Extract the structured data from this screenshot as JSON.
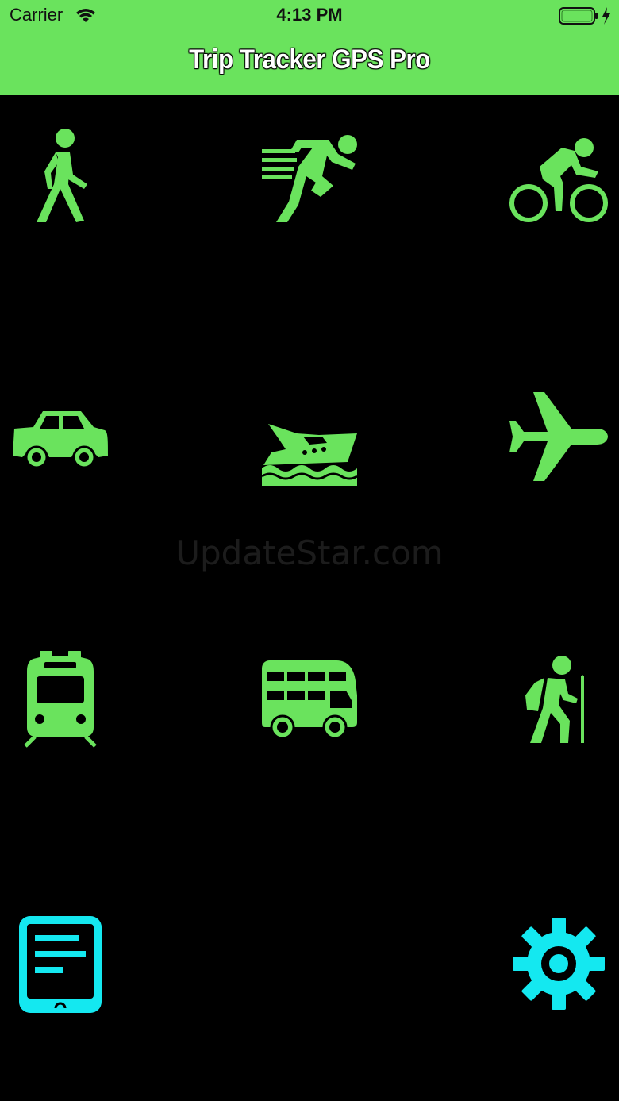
{
  "status_bar": {
    "carrier": "Carrier",
    "time": "4:13 PM",
    "icons": [
      "wifi-icon",
      "battery-icon",
      "charging-bolt-icon"
    ]
  },
  "nav": {
    "title": "Trip Tracker GPS Pro",
    "background_color": "#6ae35d"
  },
  "modes": [
    {
      "name": "walking",
      "icon": "walking-icon"
    },
    {
      "name": "running",
      "icon": "running-icon"
    },
    {
      "name": "cycling",
      "icon": "cycling-icon"
    },
    {
      "name": "car",
      "icon": "car-icon"
    },
    {
      "name": "boat",
      "icon": "boat-icon"
    },
    {
      "name": "airplane",
      "icon": "airplane-icon"
    },
    {
      "name": "train",
      "icon": "train-icon"
    },
    {
      "name": "bus",
      "icon": "bus-icon"
    },
    {
      "name": "hiking",
      "icon": "hiking-icon"
    }
  ],
  "bottom_actions": [
    {
      "name": "log",
      "icon": "tablet-log-icon"
    },
    {
      "name": "settings",
      "icon": "gear-icon"
    }
  ],
  "watermark": "UpdateStar.com",
  "colors": {
    "icon_green": "#6ae35d",
    "icon_cyan": "#14e8f0",
    "background": "#000000"
  }
}
